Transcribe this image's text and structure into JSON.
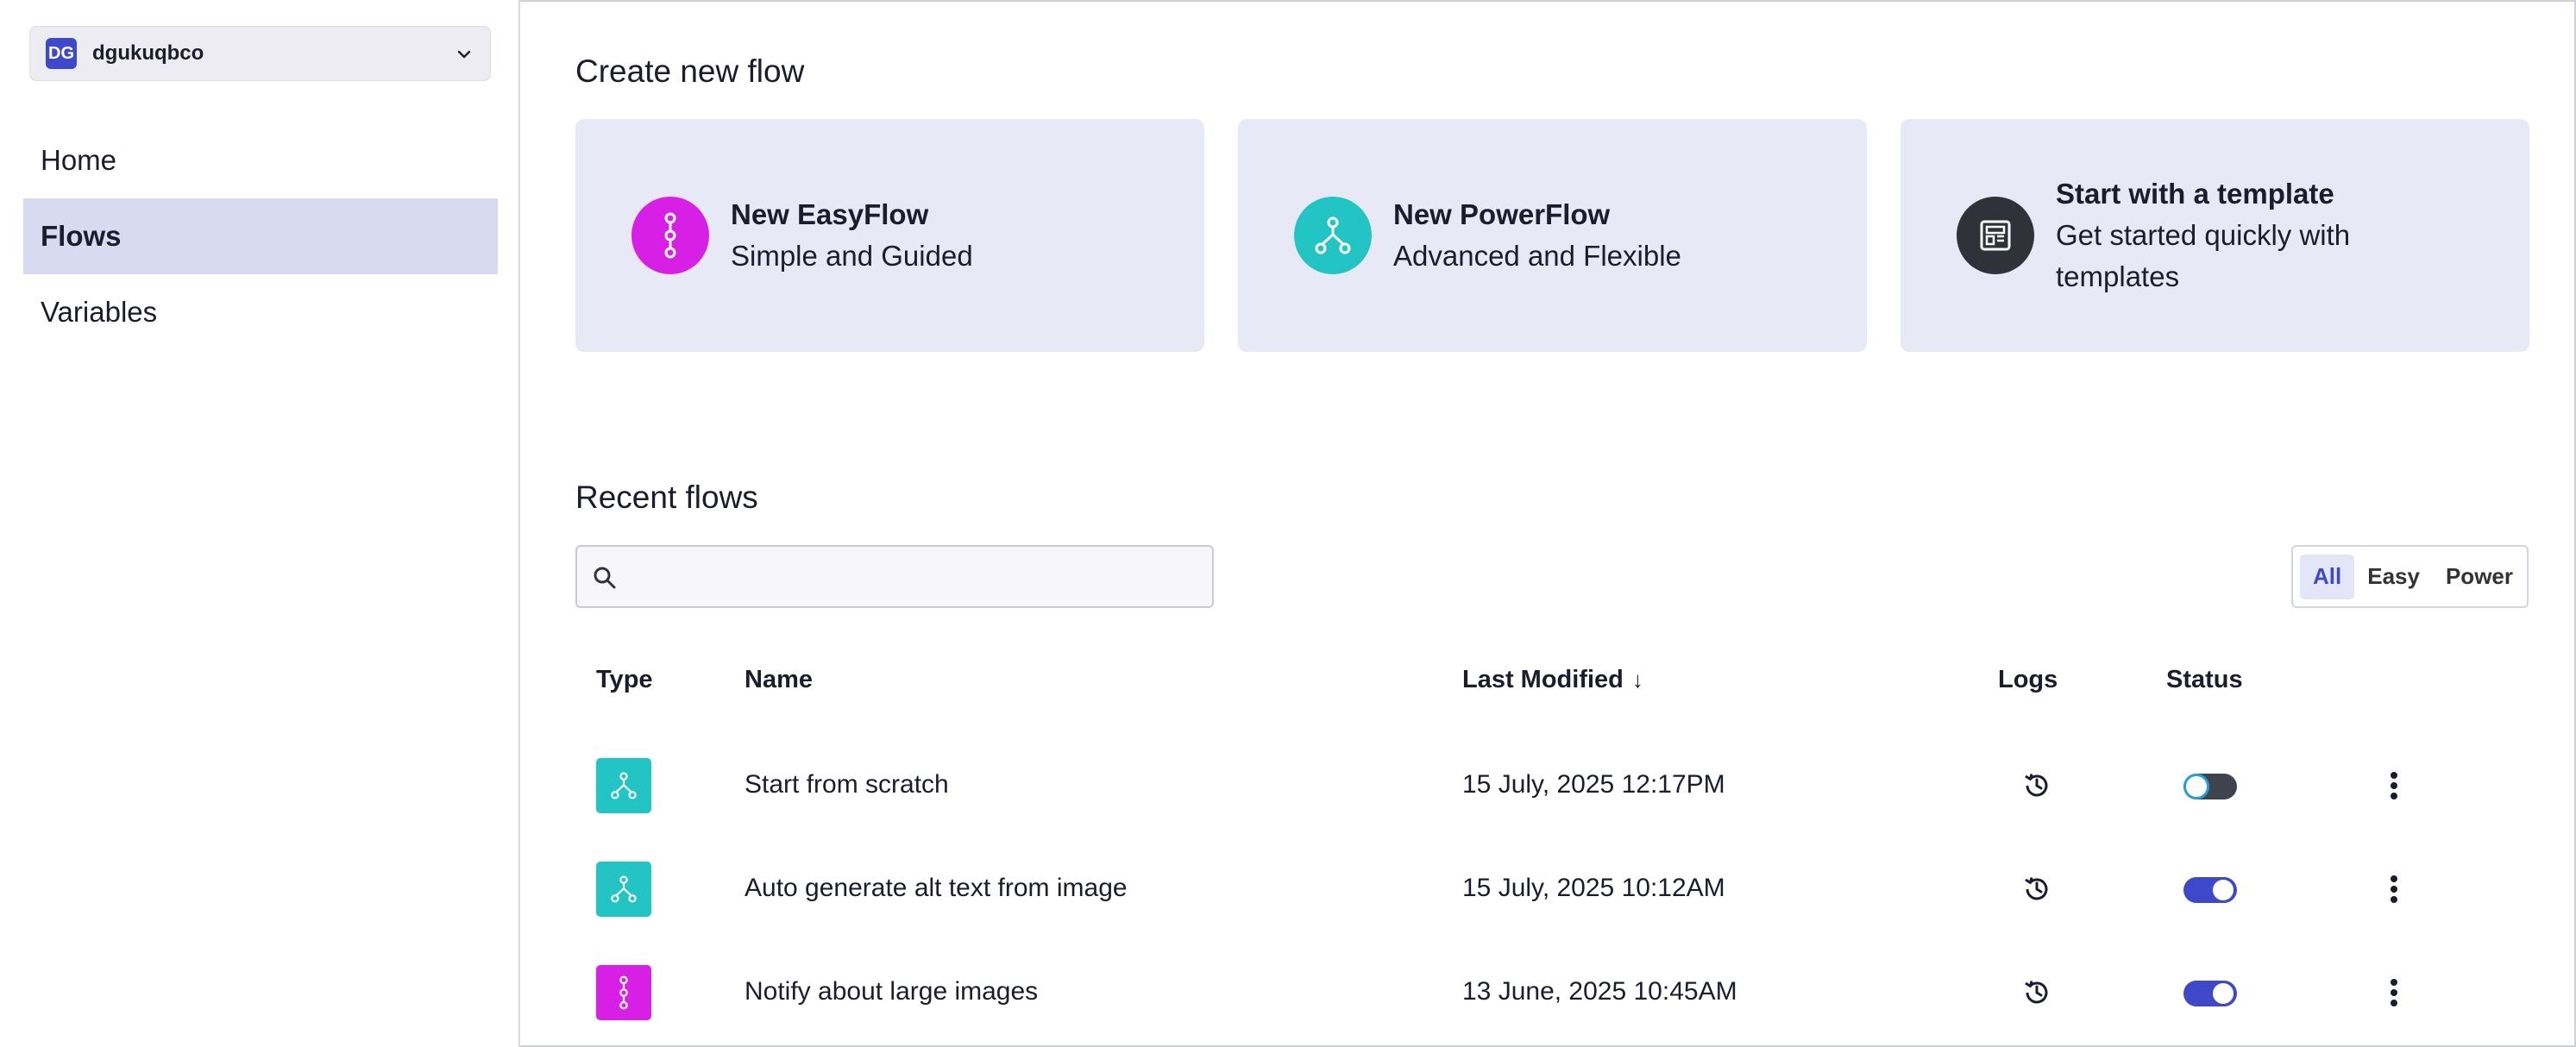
{
  "workspace": {
    "initials": "DG",
    "name": "dgukuqbco"
  },
  "nav": [
    {
      "label": "Home",
      "active": false
    },
    {
      "label": "Flows",
      "active": true
    },
    {
      "label": "Variables",
      "active": false
    }
  ],
  "create_section": {
    "title": "Create new flow"
  },
  "cards": [
    {
      "title": "New EasyFlow",
      "subtitle": "Simple and Guided",
      "icon": "easyflow-icon",
      "color": "#d81fe6"
    },
    {
      "title": "New PowerFlow",
      "subtitle": "Advanced and Flexible",
      "icon": "powerflow-icon",
      "color": "#22c4c4"
    },
    {
      "title": "Start with a template",
      "subtitle": "Get started quickly with templates",
      "icon": "template-icon",
      "color": "#2f3238"
    }
  ],
  "recent_section": {
    "title": "Recent flows"
  },
  "search": {
    "placeholder": "",
    "value": ""
  },
  "filters": [
    {
      "label": "All",
      "active": true
    },
    {
      "label": "Easy",
      "active": false
    },
    {
      "label": "Power",
      "active": false
    }
  ],
  "table": {
    "headers": {
      "type": "Type",
      "name": "Name",
      "last_modified": "Last Modified",
      "logs": "Logs",
      "status": "Status"
    },
    "sort_indicator": "↓",
    "rows": [
      {
        "type": "power",
        "name": "Start from scratch",
        "last_modified": "15 July, 2025 12:17PM",
        "status": "off"
      },
      {
        "type": "power",
        "name": "Auto generate alt text from image",
        "last_modified": "15 July, 2025 10:12AM",
        "status": "on"
      },
      {
        "type": "easy",
        "name": "Notify about large images",
        "last_modified": "13 June, 2025 10:45AM",
        "status": "on"
      }
    ]
  },
  "colors": {
    "accent": "#3e49c9",
    "easy": "#d81fe6",
    "power": "#22c4c4",
    "card_bg": "#e8e9f6",
    "nav_active": "#d8daf2"
  }
}
